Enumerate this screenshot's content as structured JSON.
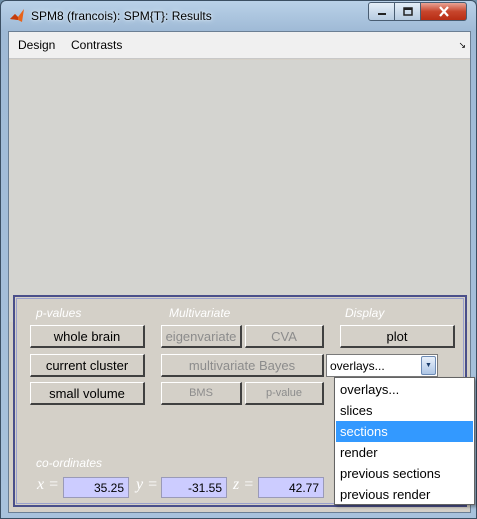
{
  "window": {
    "title": "SPM8 (francois): SPM{T}: Results"
  },
  "menubar": {
    "items": [
      {
        "label": "Design"
      },
      {
        "label": "Contrasts"
      }
    ]
  },
  "panel": {
    "headings": {
      "pvalues": "p-values",
      "multivariate": "Multivariate",
      "display": "Display",
      "coordinates": "co-ordinates"
    },
    "pvalue_buttons": [
      {
        "label": "whole brain"
      },
      {
        "label": "current cluster"
      },
      {
        "label": "small volume"
      }
    ],
    "multivariate_buttons": {
      "eigenvariate": "eigenvariate",
      "cva": "CVA",
      "bayes": "multivariate Bayes",
      "bms": "BMS",
      "pvalue": "p-value"
    },
    "display": {
      "plot": "plot",
      "overlays_selected": "overlays..."
    },
    "coordinates": {
      "x_label": "x =",
      "y_label": "y =",
      "z_label": "z =",
      "x": "35.25",
      "y": "-31.55",
      "z": "42.77"
    }
  },
  "dropdown": {
    "options": [
      {
        "label": "overlays...",
        "selected": false
      },
      {
        "label": "slices",
        "selected": false
      },
      {
        "label": "sections",
        "selected": true
      },
      {
        "label": "render",
        "selected": false
      },
      {
        "label": "previous sections",
        "selected": false
      },
      {
        "label": "previous render",
        "selected": false
      }
    ]
  },
  "colors": {
    "panel_border": "#4a4f8a",
    "coord_field": "#ccccff",
    "selection": "#3399ff"
  }
}
